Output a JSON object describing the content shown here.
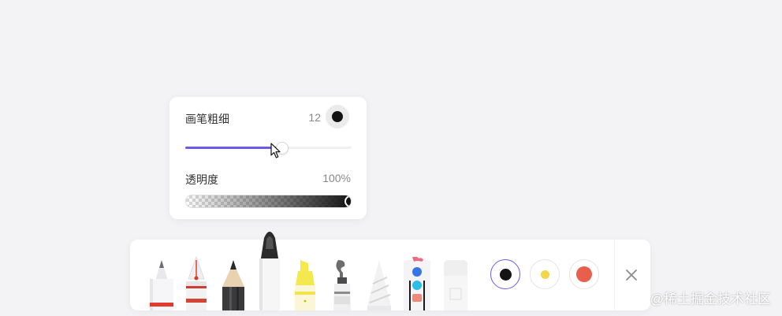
{
  "brush_panel": {
    "thickness_label": "画笔粗细",
    "thickness_value": "12",
    "thickness_level": 0.58,
    "thickness_color": "#141414",
    "accent_color": "#6b5ce7",
    "opacity_label": "透明度",
    "opacity_value": "100%",
    "opacity_level": 1.0
  },
  "toolbar": {
    "tools": [
      {
        "name": "pencil",
        "icon": "pencil-icon"
      },
      {
        "name": "fountain-pen",
        "icon": "fountain-pen-icon"
      },
      {
        "name": "wood-pencil",
        "icon": "wood-pencil-icon"
      },
      {
        "name": "marker",
        "icon": "marker-icon",
        "selected": true
      },
      {
        "name": "highlighter",
        "icon": "highlighter-icon"
      },
      {
        "name": "paint-tube",
        "icon": "paint-tube-icon"
      },
      {
        "name": "crayon",
        "icon": "crayon-icon"
      },
      {
        "name": "shape-tool",
        "icon": "shape-tool-icon"
      },
      {
        "name": "eraser",
        "icon": "eraser-icon"
      }
    ],
    "colors": [
      {
        "name": "black",
        "hex": "#141414",
        "selected": true
      },
      {
        "name": "yellow",
        "hex": "#f2d64b"
      },
      {
        "name": "red",
        "hex": "#e8604c"
      }
    ],
    "close_icon": "close-icon"
  },
  "watermark": "@稀土掘金技术社区"
}
